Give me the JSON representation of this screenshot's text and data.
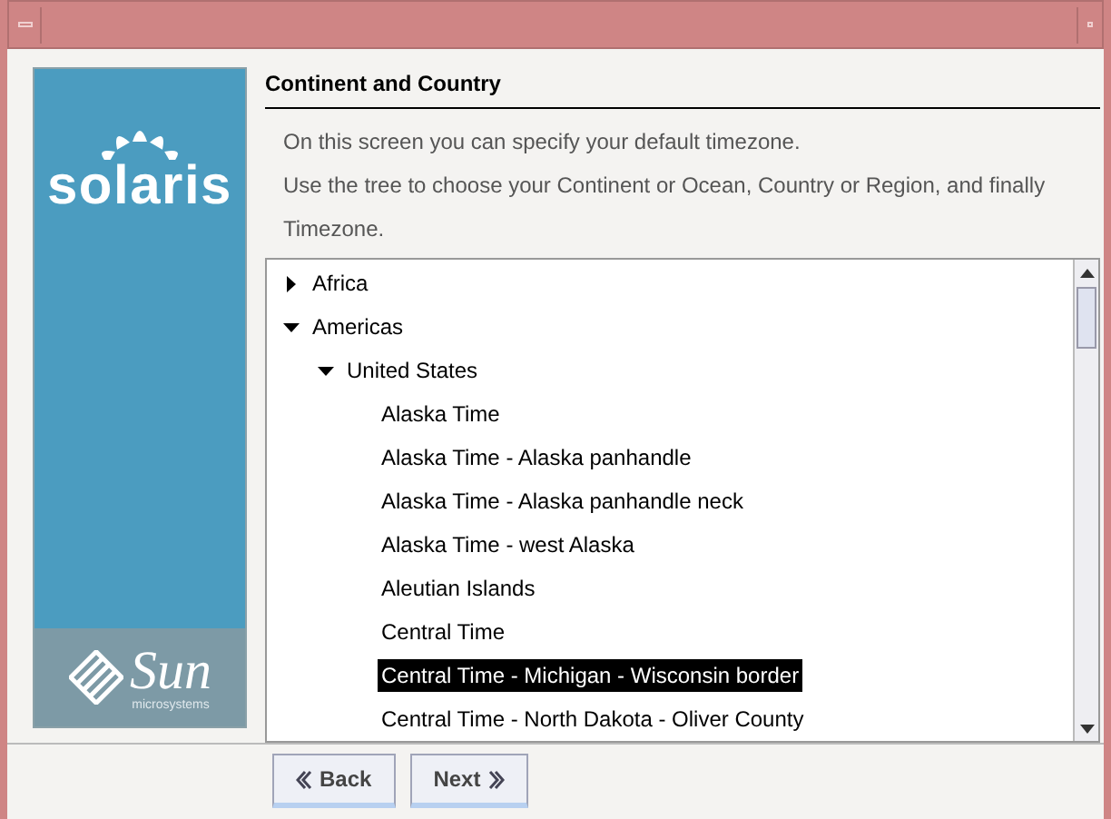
{
  "sidebar": {
    "logo_top": "solaris",
    "logo_bottom": "Sun",
    "logo_bottom_sub": "microsystems"
  },
  "heading": "Continent and Country",
  "description": [
    "On this screen you can specify your default timezone.",
    "Use the tree to choose your Continent or Ocean, Country or Region, and finally Timezone."
  ],
  "tree": [
    {
      "label": "Africa",
      "expanded": false,
      "selected": false
    },
    {
      "label": "Americas",
      "expanded": true,
      "selected": false,
      "children": [
        {
          "label": "United States",
          "expanded": true,
          "selected": false,
          "children": [
            {
              "label": "Alaska Time",
              "selected": false
            },
            {
              "label": "Alaska Time - Alaska panhandle",
              "selected": false
            },
            {
              "label": "Alaska Time - Alaska panhandle neck",
              "selected": false
            },
            {
              "label": "Alaska Time - west Alaska",
              "selected": false
            },
            {
              "label": "Aleutian Islands",
              "selected": false
            },
            {
              "label": "Central Time",
              "selected": false
            },
            {
              "label": "Central Time - Michigan - Wisconsin border",
              "selected": true
            },
            {
              "label": "Central Time - North Dakota - Oliver County",
              "selected": false
            }
          ]
        }
      ]
    }
  ],
  "buttons": [
    {
      "label": "Back",
      "kind": "back"
    },
    {
      "label": "Next",
      "kind": "next"
    }
  ]
}
